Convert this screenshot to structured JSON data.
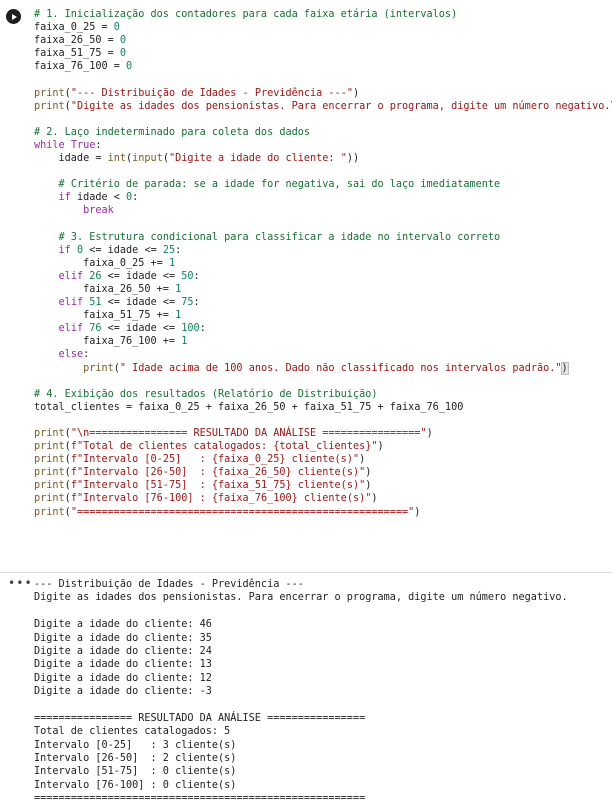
{
  "cell": {
    "run_icon": "play-icon",
    "code_lines": [
      "# 1. Inicialização dos contadores para cada faixa etária (intervalos)",
      "faixa_0_25 = 0",
      "faixa_26_50 = 0",
      "faixa_51_75 = 0",
      "faixa_76_100 = 0",
      "",
      "print(\"--- Distribuição de Idades - Previdência ---\")",
      "print(\"Digite as idades dos pensionistas. Para encerrar o programa, digite um número negativo.\\n\")",
      "",
      "# 2. Laço indeterminado para coleta dos dados",
      "while True:",
      "    idade = int(input(\"Digite a idade do cliente: \"))",
      "",
      "    # Critério de parada: se a idade for negativa, sai do laço imediatamente",
      "    if idade < 0:",
      "        break",
      "",
      "    # 3. Estrutura condicional para classificar a idade no intervalo correto",
      "    if 0 <= idade <= 25:",
      "        faixa_0_25 += 1",
      "    elif 26 <= idade <= 50:",
      "        faixa_26_50 += 1",
      "    elif 51 <= idade <= 75:",
      "        faixa_51_75 += 1",
      "    elif 76 <= idade <= 100:",
      "        faixa_76_100 += 1",
      "    else:",
      "        print(\" Idade acima de 100 anos. Dado não classificado nos intervalos padrão.\")",
      "",
      "# 4. Exibição dos resultados (Relatório de Distribuição)",
      "total_clientes = faixa_0_25 + faixa_26_50 + faixa_51_75 + faixa_76_100",
      "",
      "print(\"\\n================ RESULTADO DA ANÁLISE ================\")",
      "print(f\"Total de clientes catalogados: {total_clientes}\")",
      "print(f\"Intervalo [0-25]   : {faixa_0_25} cliente(s)\")",
      "print(f\"Intervalo [26-50]  : {faixa_26_50} cliente(s)\")",
      "print(f\"Intervalo [51-75]  : {faixa_51_75} cliente(s)\")",
      "print(f\"Intervalo [76-100] : {faixa_76_100} cliente(s)\")",
      "print(\"======================================================\")"
    ]
  },
  "output": {
    "menu_icon": "more-horizontal-icon",
    "lines": [
      "--- Distribuição de Idades - Previdência ---",
      "Digite as idades dos pensionistas. Para encerrar o programa, digite um número negativo.",
      "",
      "Digite a idade do cliente: 46",
      "Digite a idade do cliente: 35",
      "Digite a idade do cliente: 24",
      "Digite a idade do cliente: 13",
      "Digite a idade do cliente: 12",
      "Digite a idade do cliente: -3",
      "",
      "================ RESULTADO DA ANÁLISE ================",
      "Total de clientes catalogados: 5",
      "Intervalo [0-25]   : 3 cliente(s)",
      "Intervalo [26-50]  : 2 cliente(s)",
      "Intervalo [51-75]  : 0 cliente(s)",
      "Intervalo [76-100] : 0 cliente(s)",
      "======================================================"
    ]
  },
  "colors": {
    "comment": "#137333",
    "keyword": "#9c27b0",
    "string": "#a31515",
    "number": "#098658",
    "function": "#795e26"
  }
}
